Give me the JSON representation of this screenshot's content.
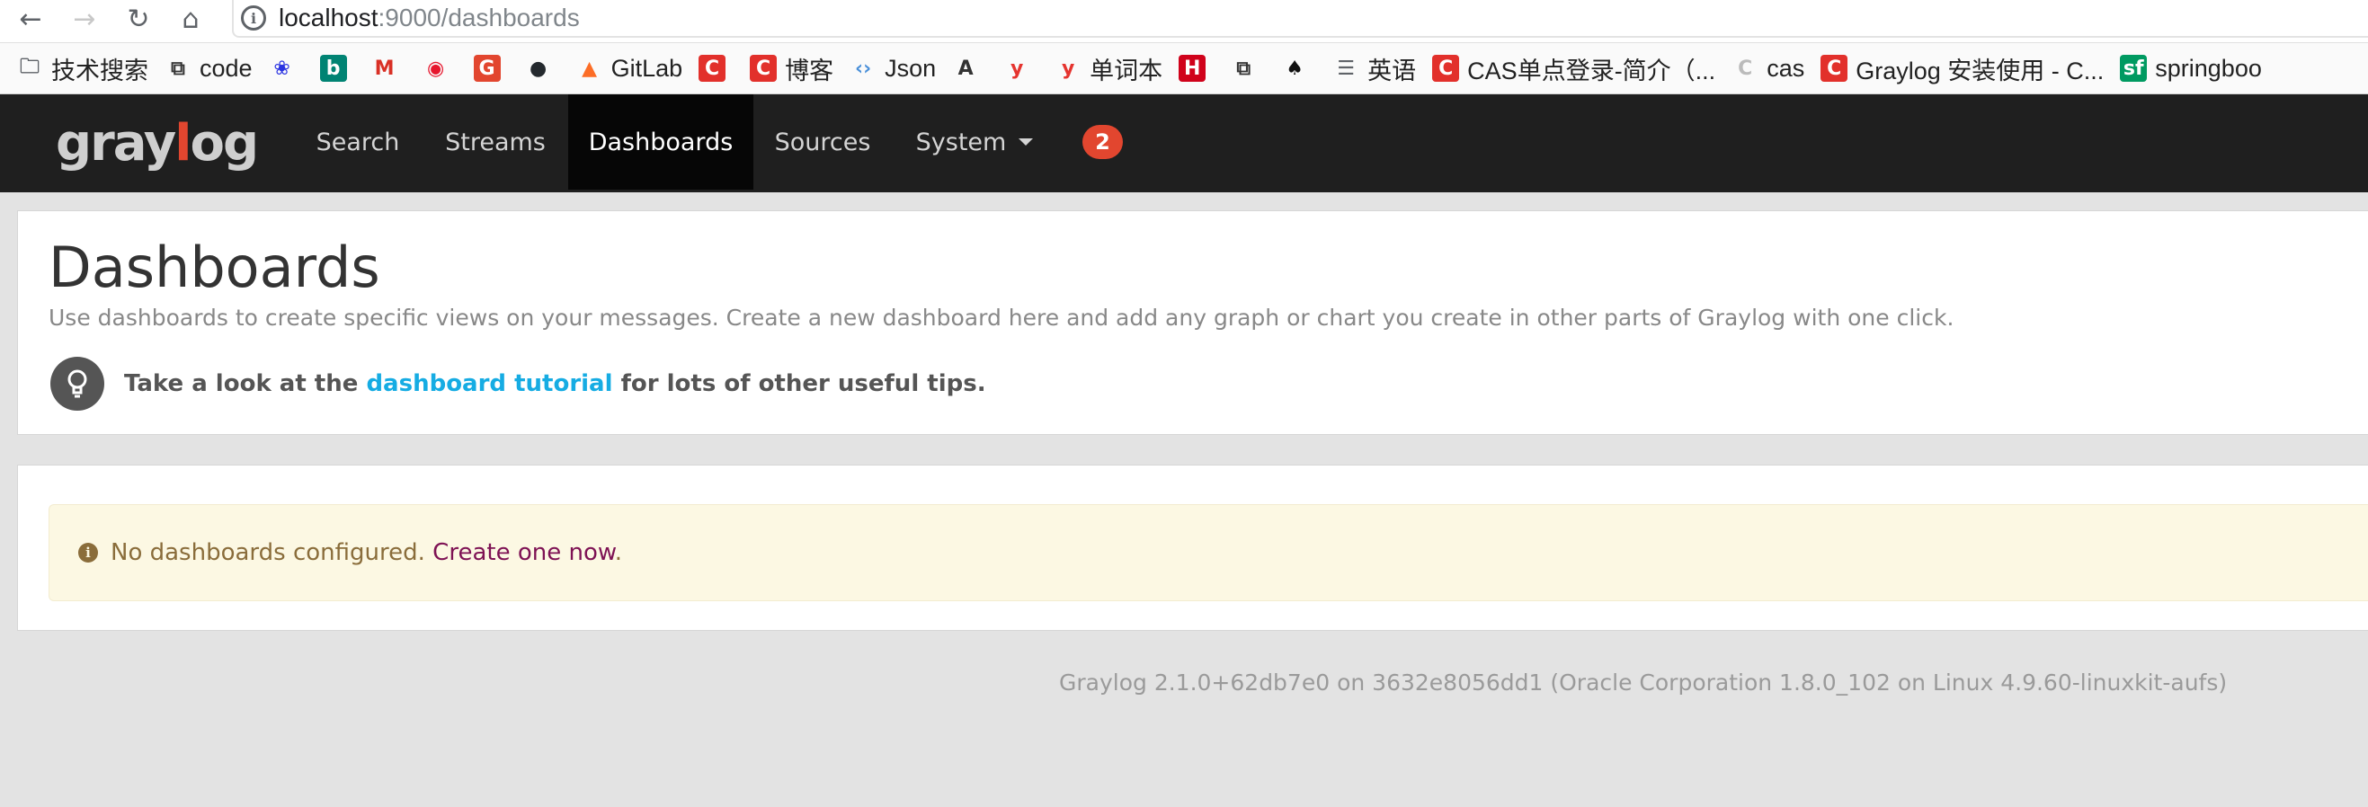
{
  "browser": {
    "url_host": "localhost",
    "url_path": ":9000/dashboards",
    "bookmarks": [
      {
        "label": "技术搜索",
        "icon": "folder-icon",
        "color": "#5f6368"
      },
      {
        "label": "code",
        "icon": "link-icon",
        "color": "#333333"
      },
      {
        "label": "",
        "icon": "baidu-paw-icon",
        "color": "#2932e1"
      },
      {
        "label": "",
        "icon": "bing-icon",
        "color": "#008373"
      },
      {
        "label": "",
        "icon": "gmail-icon",
        "color": "#d93025"
      },
      {
        "label": "",
        "icon": "weibo-icon",
        "color": "#e6162d"
      },
      {
        "label": "",
        "icon": "g-red-icon",
        "color": "#e2462f"
      },
      {
        "label": "",
        "icon": "github-icon",
        "color": "#24292e"
      },
      {
        "label": "GitLab",
        "icon": "gitlab-fox-icon",
        "color": "#fc6d26"
      },
      {
        "label": "",
        "icon": "csdn-icon",
        "color": "#e2302b"
      },
      {
        "label": "博客",
        "icon": "csdn-icon",
        "color": "#e2302b"
      },
      {
        "label": "Json",
        "icon": "code-brackets-icon",
        "color": "#4a90d9"
      },
      {
        "label": "",
        "icon": "script-a-icon",
        "color": "#333333"
      },
      {
        "label": "",
        "icon": "youdao-y-icon",
        "color": "#e5342f"
      },
      {
        "label": "单词本",
        "icon": "youdao-y-icon",
        "color": "#e5342f"
      },
      {
        "label": "",
        "icon": "h-badge-icon",
        "color": "#d0021b"
      },
      {
        "label": "",
        "icon": "link-icon",
        "color": "#333333"
      },
      {
        "label": "",
        "icon": "spade-icon",
        "color": "#111111"
      },
      {
        "label": "英语",
        "icon": "document-icon",
        "color": "#5f6368"
      },
      {
        "label": "CAS单点登录-简介（...",
        "icon": "csdn-icon",
        "color": "#e2302b"
      },
      {
        "label": "cas",
        "icon": "cas-logo-icon",
        "color": "#bbbbbb"
      },
      {
        "label": "Graylog 安装使用 - C...",
        "icon": "csdn-icon",
        "color": "#e2302b"
      },
      {
        "label": "springboo",
        "icon": "segmentfault-icon",
        "color": "#009a61"
      }
    ]
  },
  "navbar": {
    "logo": {
      "part1": "gray",
      "part2": "l",
      "part3": "og"
    },
    "items": [
      "Search",
      "Streams",
      "Dashboards",
      "Sources",
      "System"
    ],
    "active": "Dashboards",
    "notification_count": "2",
    "background": "#1f1f1f",
    "accent": "#e2462f"
  },
  "page": {
    "title": "Dashboards",
    "description": "Use dashboards to create specific views on your messages. Create a new dashboard here and add any graph or chart you create in other parts of Graylog with one click.",
    "tip_prefix": "Take a look at the ",
    "tip_link": "dashboard tutorial",
    "tip_suffix": " for lots of other useful tips.",
    "alert_text": "No dashboards configured. ",
    "alert_link": "Create one now",
    "alert_end": ".",
    "footer": "Graylog 2.1.0+62db7e0 on 3632e8056dd1 (Oracle Corporation 1.8.0_102 on Linux 4.9.60-linuxkit-aufs)"
  }
}
